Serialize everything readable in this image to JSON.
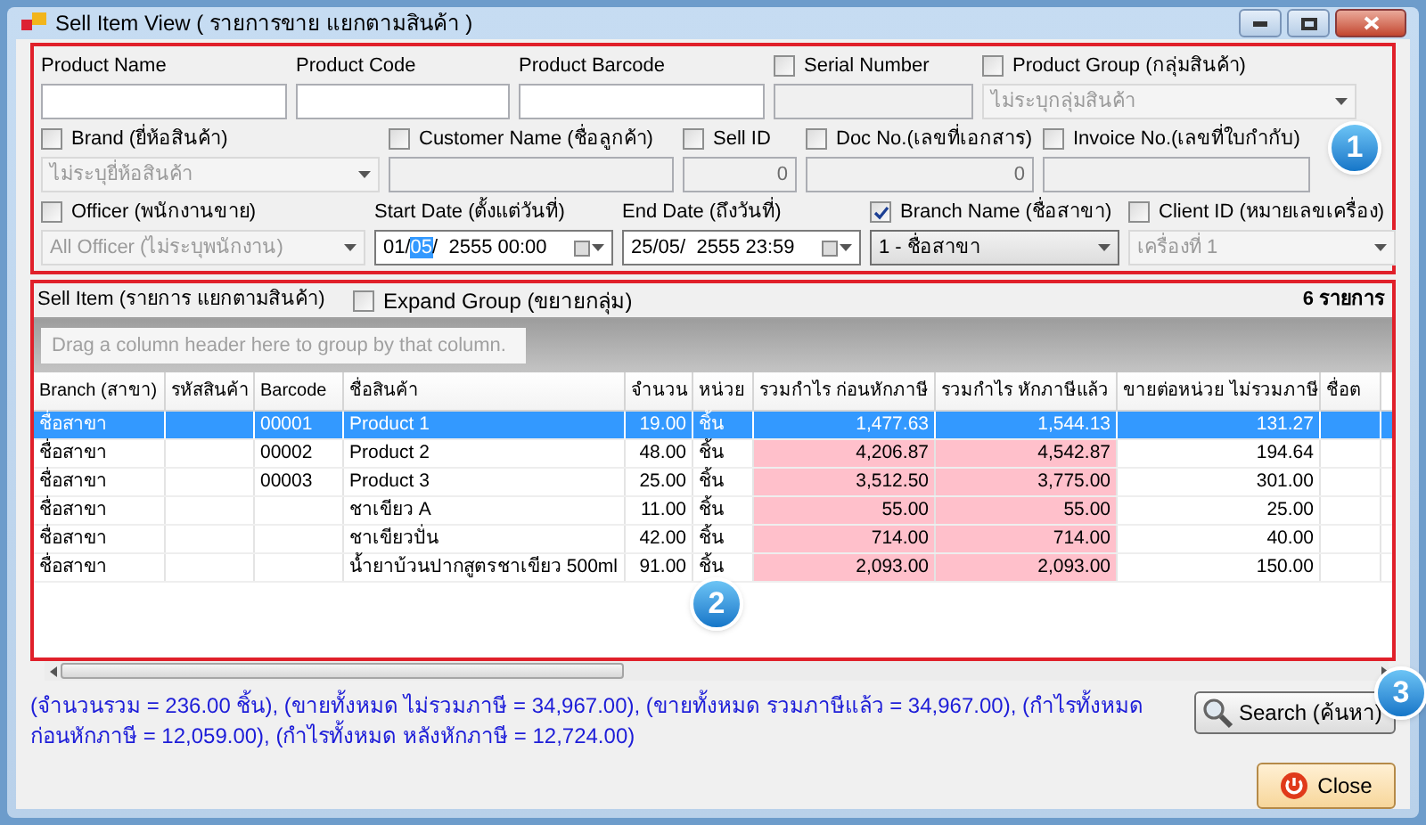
{
  "window": {
    "title": "Sell Item View ( รายการขาย แยกตามสินค้า )"
  },
  "filter_rows": [
    [
      {
        "kind": "text",
        "label": "Product Name"
      },
      {
        "kind": "text",
        "label": "Product Code"
      },
      {
        "kind": "text",
        "label": "Product Barcode"
      },
      {
        "kind": "check_text",
        "label": "Serial Number",
        "checked": false
      },
      {
        "kind": "check_select",
        "label": "Product Group (กลุ่มสินค้า)",
        "checked": false,
        "value": "ไม่ระบุกลุ่มสินค้า"
      }
    ],
    [
      {
        "kind": "check_select",
        "label": "Brand (ยี่ห้อสินค้า)",
        "checked": false,
        "value": "ไม่ระบุยี่ห้อสินค้า"
      },
      {
        "kind": "check_text",
        "label": "Customer Name (ชื่อลูกค้า)",
        "checked": false
      },
      {
        "kind": "check_text",
        "label": "Sell ID",
        "checked": false,
        "value": "0"
      },
      {
        "kind": "check_text",
        "label": "Doc No.(เลขที่เอกสาร)",
        "checked": false,
        "value": "0"
      },
      {
        "kind": "check_text",
        "label": "Invoice No.(เลขที่ใบกำกับ)",
        "checked": false
      }
    ],
    [
      {
        "kind": "check_select",
        "label": "Officer (พนักงานขาย)",
        "checked": false,
        "value": "All Officer (ไม่ระบุพนักงาน)"
      },
      {
        "kind": "date",
        "label": "Start Date (ตั้งแต่วันที่)",
        "value_before": "01/",
        "value_selected": "05",
        "value_after": "/  2555 00:00"
      },
      {
        "kind": "date",
        "label": "End Date (ถึงวันที่)",
        "value_before": "25/05/  2555 23:59"
      },
      {
        "kind": "check_select",
        "label": "Branch Name (ชื่อสาขา)",
        "checked": true,
        "value": "1 - ชื่อสาขา"
      },
      {
        "kind": "check_select",
        "label": "Client ID (หมายเลขเครื่อง)",
        "checked": false,
        "value": "เครื่องที่ 1"
      }
    ]
  ],
  "badges": [
    "1",
    "2",
    "3"
  ],
  "grid": {
    "title": "Sell Item (รายการ แยกตามสินค้า)",
    "expand_group": {
      "label": "Expand Group (ขยายกลุ่ม)",
      "checked": false
    },
    "count": "6 รายการ",
    "group_panel_hint": "Drag a column header here to group by that column.",
    "columns": [
      {
        "label": "Branch (สาขา)",
        "kind": "text"
      },
      {
        "label": "รหัสสินค้า",
        "kind": "text"
      },
      {
        "label": "Barcode",
        "kind": "text"
      },
      {
        "label": "ชื่อสินค้า",
        "kind": "text"
      },
      {
        "label": "จำนวน",
        "kind": "number"
      },
      {
        "label": "หน่วย",
        "kind": "text"
      },
      {
        "label": "รวมกำไร ก่อนหักภาษี",
        "kind": "profit"
      },
      {
        "label": "รวมกำไร หักภาษีแล้ว",
        "kind": "profit"
      },
      {
        "label": "ขายต่อหน่วย ไม่รวมภาษี",
        "kind": "number"
      },
      {
        "label": "ชื่อต",
        "kind": "text"
      }
    ],
    "rows": [
      {
        "selected": true,
        "cells": [
          "ชื่อสาขา",
          "",
          "00001",
          "Product 1",
          "19.00",
          "ชิ้น",
          "1,477.63",
          "1,544.13",
          "131.27",
          ""
        ]
      },
      {
        "selected": false,
        "cells": [
          "ชื่อสาขา",
          "",
          "00002",
          "Product 2",
          "48.00",
          "ชิ้น",
          "4,206.87",
          "4,542.87",
          "194.64",
          ""
        ]
      },
      {
        "selected": false,
        "cells": [
          "ชื่อสาขา",
          "",
          "00003",
          "Product 3",
          "25.00",
          "ชิ้น",
          "3,512.50",
          "3,775.00",
          "301.00",
          ""
        ]
      },
      {
        "selected": false,
        "cells": [
          "ชื่อสาขา",
          "",
          "",
          "ชาเขียว A",
          "11.00",
          "ชิ้น",
          "55.00",
          "55.00",
          "25.00",
          ""
        ]
      },
      {
        "selected": false,
        "cells": [
          "ชื่อสาขา",
          "",
          "",
          "ชาเขียวปั่น",
          "42.00",
          "ชิ้น",
          "714.00",
          "714.00",
          "40.00",
          ""
        ]
      },
      {
        "selected": false,
        "cells": [
          "ชื่อสาขา",
          "",
          "",
          "น้ำยาบ้วนปากสูตรชาเขียว  500ml",
          "91.00",
          "ชิ้น",
          "2,093.00",
          "2,093.00",
          "150.00",
          ""
        ]
      }
    ]
  },
  "summary": "(จำนวนรวม = 236.00 ชิ้น), (ขายทั้งหมด ไม่รวมภาษี = 34,967.00), (ขายทั้งหมด รวมภาษีแล้ว = 34,967.00), (กำไรทั้งหมด ก่อนหักภาษี = 12,059.00), (กำไรทั้งหมด หลังหักภาษี = 12,724.00)",
  "buttons": {
    "search": "Search (ค้นหา)",
    "close": "Close"
  }
}
